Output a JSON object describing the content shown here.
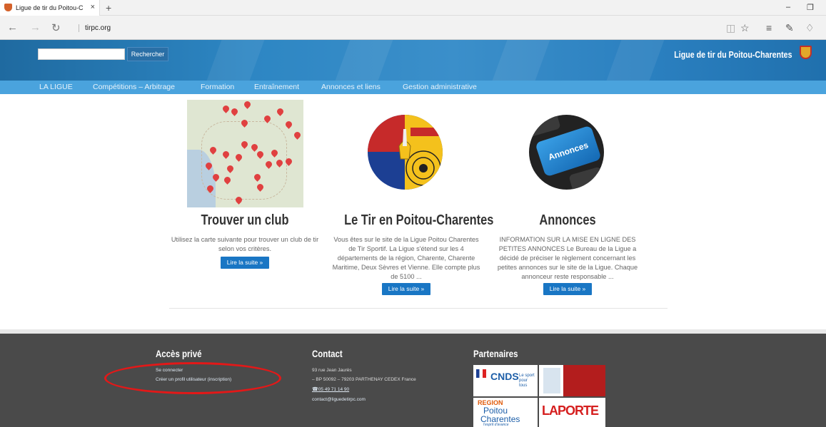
{
  "browser": {
    "tab_title": "Ligue de tir du Poitou-C",
    "tab_close": "×",
    "new_tab": "+",
    "url": "tirpc.org",
    "back": "←",
    "forward": "→",
    "refresh": "↻",
    "minimize": "–",
    "restore": "❐",
    "tools": [
      "◫",
      "☆",
      "≡",
      "✎",
      "♢"
    ]
  },
  "header": {
    "search_placeholder": "",
    "search_button": "Rechercher",
    "site_title": "Ligue de tir du Poitou-Charentes"
  },
  "menu": [
    "LA LIGUE",
    "Compétitions – Arbitrage",
    "Formation",
    "Entraînement",
    "Annonces et liens",
    "Gestion administrative"
  ],
  "columns": [
    {
      "heading": "Trouver un club",
      "text": "Utilisez la carte suivante pour trouver un club de tir selon vos critères.",
      "button": "Lire la suite »"
    },
    {
      "heading": "Le Tir en Poitou-Charentes",
      "text": "Vous êtes sur le site de la Ligue Poitou Charentes de Tir Sportif. La Ligue s'étend sur les 4 départements de la région, Charente, Charente Maritime, Deux Sèvres et Vienne. Elle compte plus de 5100 ...",
      "button": "Lire la suite »"
    },
    {
      "heading": "Annonces",
      "text": "INFORMATION SUR LA MISE EN LIGNE DES PETITES ANNONCES Le Bureau de la Ligue a décidé de préciser le règlement concernant les petites annonces sur le site de la Ligue. Chaque annonceur reste responsable ...",
      "button": "Lire la suite »",
      "key_label": "Annonces"
    }
  ],
  "footer": {
    "private": {
      "title": "Accès privé",
      "login": "Se connecter",
      "register": "Créer un profil utilisateur (inscription)"
    },
    "contact": {
      "title": "Contact",
      "address1": "93 rue Jean Jaurès",
      "address2": "– BP 50092 – 79203 PARTHENAY CEDEX France",
      "phone": "05 49 71 14 90",
      "email": "contact@liguedetirpc.com"
    },
    "partners": {
      "title": "Partenaires",
      "cnds": "CNDS",
      "cnds_tag": "Le sport pour tous",
      "region_1": "REGION",
      "region_2": "Poitou",
      "region_3": "Charentes",
      "region_4": "l'esprit d'avance",
      "laporte": "LAPORTE"
    }
  }
}
